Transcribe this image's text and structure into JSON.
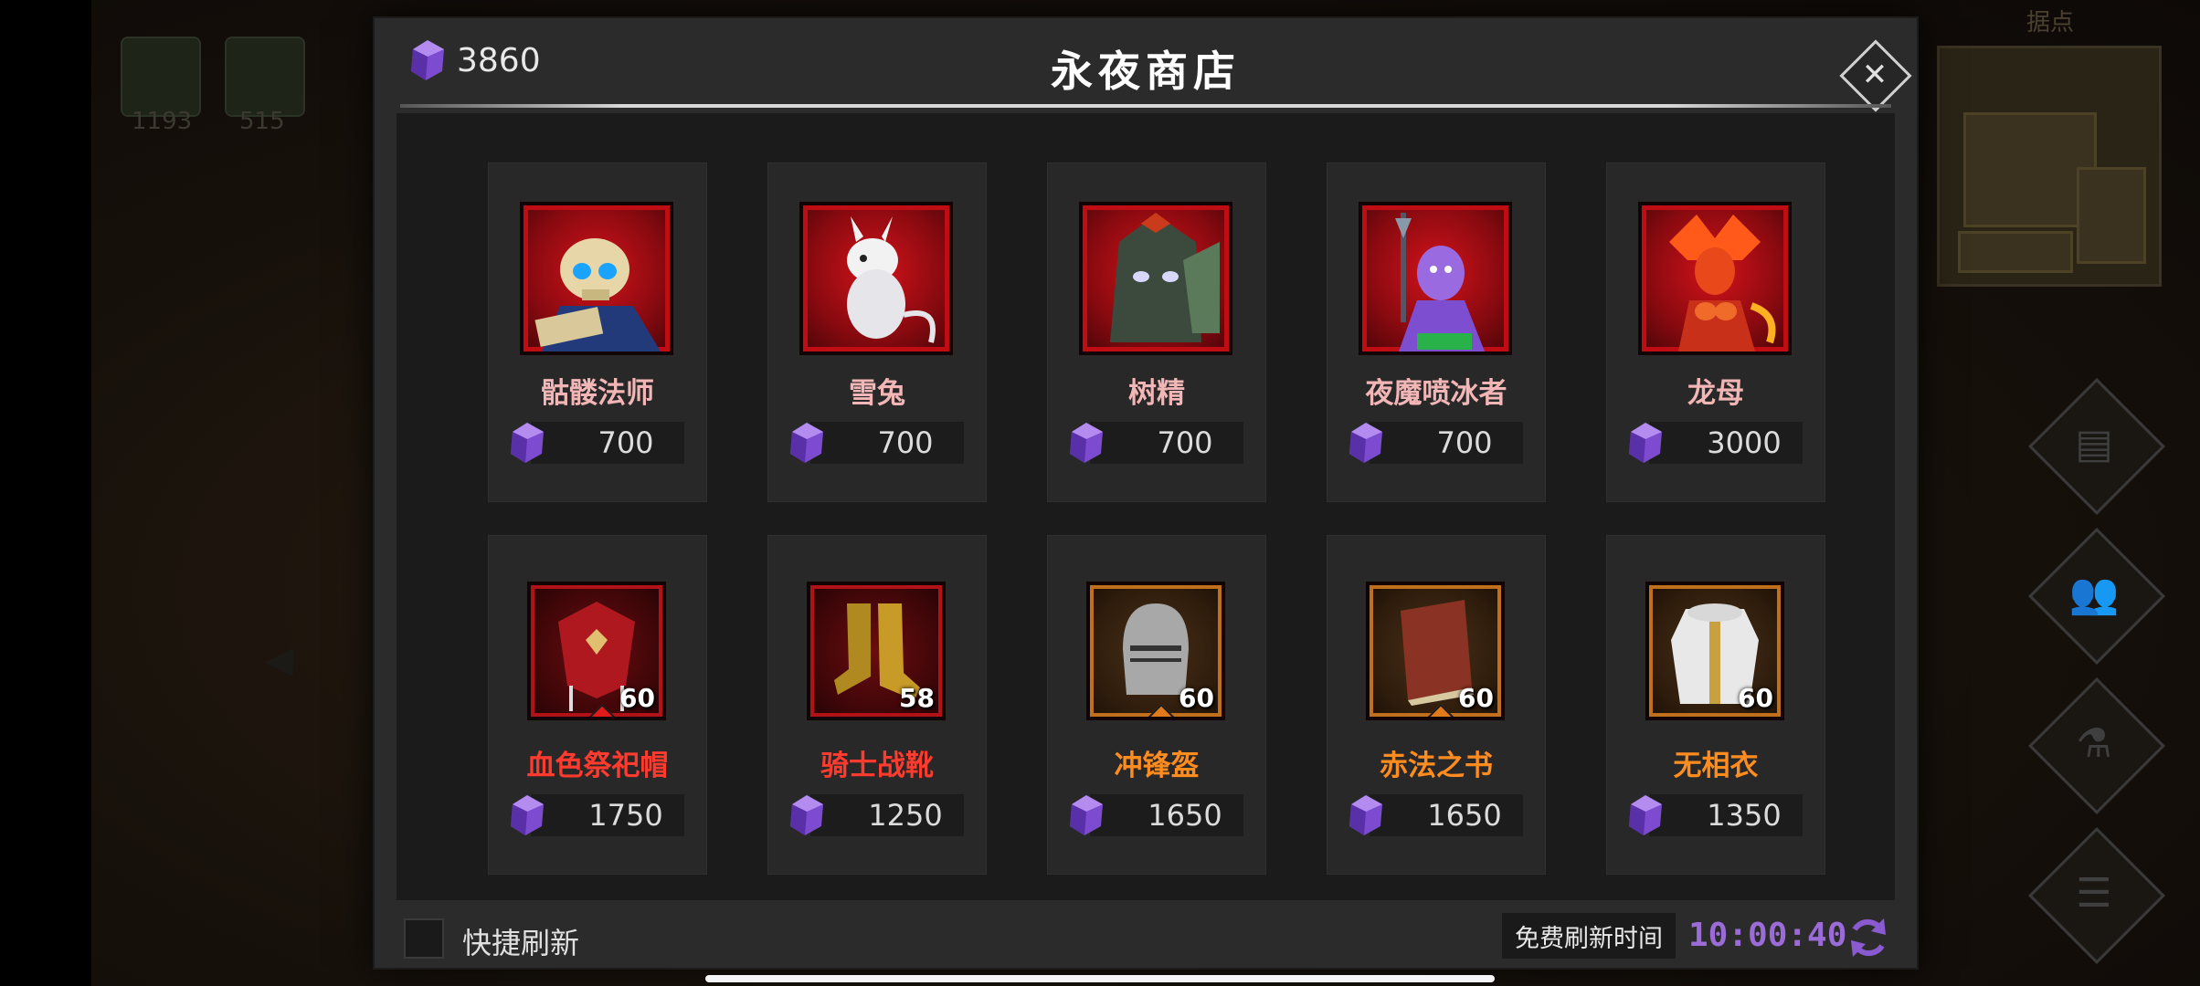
{
  "background": {
    "hud_counters": [
      "1193",
      "515"
    ],
    "minimap_label": "据点",
    "side_menu_icons": [
      "scroll-icon",
      "team-icon",
      "potion-icon",
      "list-icon"
    ]
  },
  "shop": {
    "title": "永夜商店",
    "gem_balance": "3860",
    "close_icon": "close-icon",
    "colors": {
      "accent_purple": "#9b6bd8",
      "hero_name": "#f2b6b6",
      "rarity_red": "#ff3a2e",
      "rarity_orange": "#ff8c1e"
    },
    "heroes": [
      {
        "name": "骷髅法师",
        "price": "700",
        "icon": "skeleton-mage-portrait"
      },
      {
        "name": "雪兔",
        "price": "700",
        "icon": "snow-rabbit-portrait"
      },
      {
        "name": "树精",
        "price": "700",
        "icon": "treant-portrait"
      },
      {
        "name": "夜魔喷冰者",
        "price": "700",
        "icon": "ice-demon-portrait"
      },
      {
        "name": "龙母",
        "price": "3000",
        "icon": "dragon-mother-portrait"
      }
    ],
    "items": [
      {
        "name": "血色祭祀帽",
        "price": "1750",
        "level": "60",
        "rarity": "red",
        "icon": "crimson-hat-icon"
      },
      {
        "name": "骑士战靴",
        "price": "1250",
        "level": "58",
        "rarity": "red",
        "icon": "knight-boots-icon"
      },
      {
        "name": "冲锋盔",
        "price": "1650",
        "level": "60",
        "rarity": "orange",
        "icon": "helmet-icon"
      },
      {
        "name": "赤法之书",
        "price": "1650",
        "level": "60",
        "rarity": "orange",
        "icon": "red-book-icon"
      },
      {
        "name": "无相衣",
        "price": "1350",
        "level": "60",
        "rarity": "orange",
        "icon": "white-robe-icon"
      }
    ],
    "footer": {
      "quick_refresh_label": "快捷刷新",
      "free_refresh_label": "免费刷新时间",
      "timer": "10:00:40",
      "refresh_icon": "refresh-icon"
    }
  }
}
